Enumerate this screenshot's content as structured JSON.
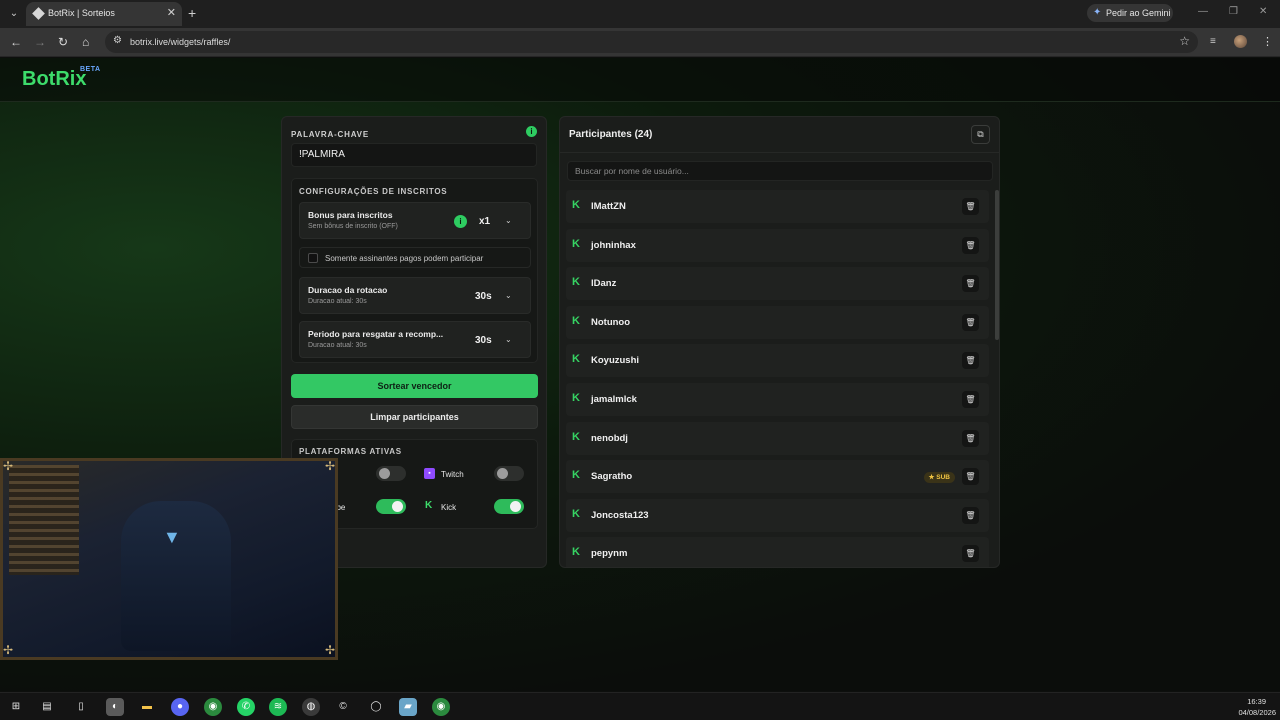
{
  "browser": {
    "tab_title": "BotRix | Sorteios",
    "new_tab_symbol": "+",
    "close_symbol": "✕",
    "gemini_label": "Pedir ao Gemini",
    "url": "botrix.live/widgets/raffles/"
  },
  "brand": {
    "name": "BotRix",
    "badge": "BETA"
  },
  "settings": {
    "keyword_label": "PALAVRA-CHAVE",
    "keyword_value": "!PALMIRA",
    "subs_title": "CONFIGURAÇÕES DE INSCRITOS",
    "bonus_title": "Bonus para inscritos",
    "bonus_sub": "Sem bônus de inscrito (OFF)",
    "bonus_value": "x1",
    "paid_only_label": "Somente assinantes pagos podem participar",
    "rotation_title": "Duracao da rotacao",
    "rotation_sub": "Duracao atual: 30s",
    "rotation_value": "30s",
    "claim_title": "Periodo para resgatar a recomp...",
    "claim_sub": "Duracao atual: 30s",
    "claim_value": "30s",
    "draw_button": "Sortear vencedor",
    "clear_button": "Limpar participantes",
    "platforms_title": "PLATAFORMAS ATIVAS",
    "platforms": [
      {
        "label": "Twitch",
        "enabled": false
      },
      {
        "label": "Kick",
        "enabled": true
      },
      {
        "label": "ube",
        "enabled": true
      }
    ]
  },
  "participants": {
    "title": "Participantes (24)",
    "search_placeholder": "Buscar por nome de usuário...",
    "sub_badge": "SUB",
    "items": [
      {
        "name": "lMattZN",
        "sub": false
      },
      {
        "name": "johninhax",
        "sub": false
      },
      {
        "name": "lDanz",
        "sub": false
      },
      {
        "name": "Notunoo",
        "sub": false
      },
      {
        "name": "Koyuzushi",
        "sub": false
      },
      {
        "name": "jamalmlck",
        "sub": false
      },
      {
        "name": "nenobdj",
        "sub": false
      },
      {
        "name": "Sagratho",
        "sub": true
      },
      {
        "name": "Joncosta123",
        "sub": false
      },
      {
        "name": "pepynm",
        "sub": false
      }
    ]
  },
  "taskbar": {
    "time": "16:39",
    "date": "04/08/2026"
  },
  "colors": {
    "accent": "#33c864",
    "kick": "#36d463",
    "twitch": "#8f4bff",
    "sub_badge": "#f0c443"
  }
}
